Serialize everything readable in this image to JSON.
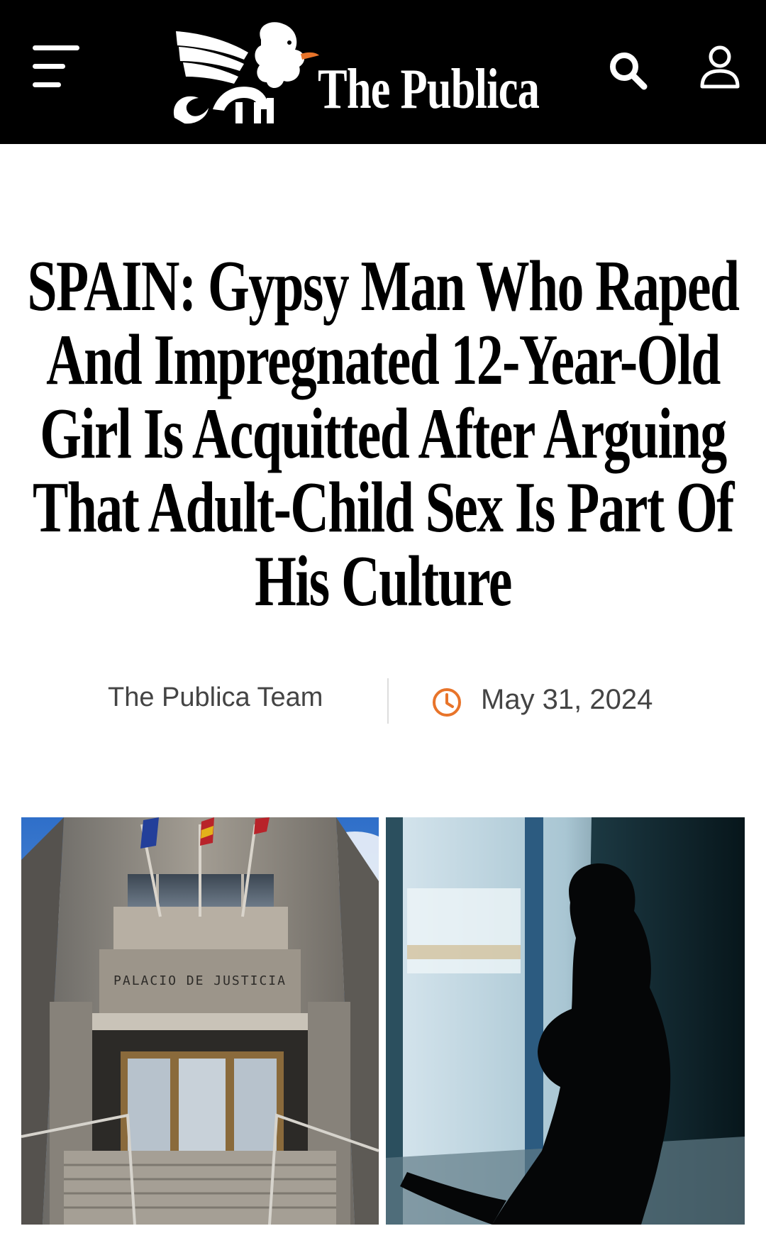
{
  "header": {
    "brand": "The Publica",
    "menu_icon": "hamburger-menu-icon",
    "search_icon": "search-icon",
    "account_icon": "user-icon",
    "background_color": "#000000"
  },
  "article": {
    "headline": "SPAIN: Gypsy Man Who Raped And Impregnated 12-Year-Old Girl Is Acquitted After Arguing That Adult-Child Sex Is Part Of His Culture",
    "author": "The Publica Team",
    "date": "May 31, 2024",
    "date_icon": "clock-icon",
    "accent_color": "#e8742a"
  },
  "hero_image": {
    "left_panel": {
      "description_icon": "courthouse-photo",
      "building_sign": "PALACIO DE JUSTICIA"
    },
    "right_panel": {
      "description_icon": "silhouette-girl-photo"
    }
  }
}
